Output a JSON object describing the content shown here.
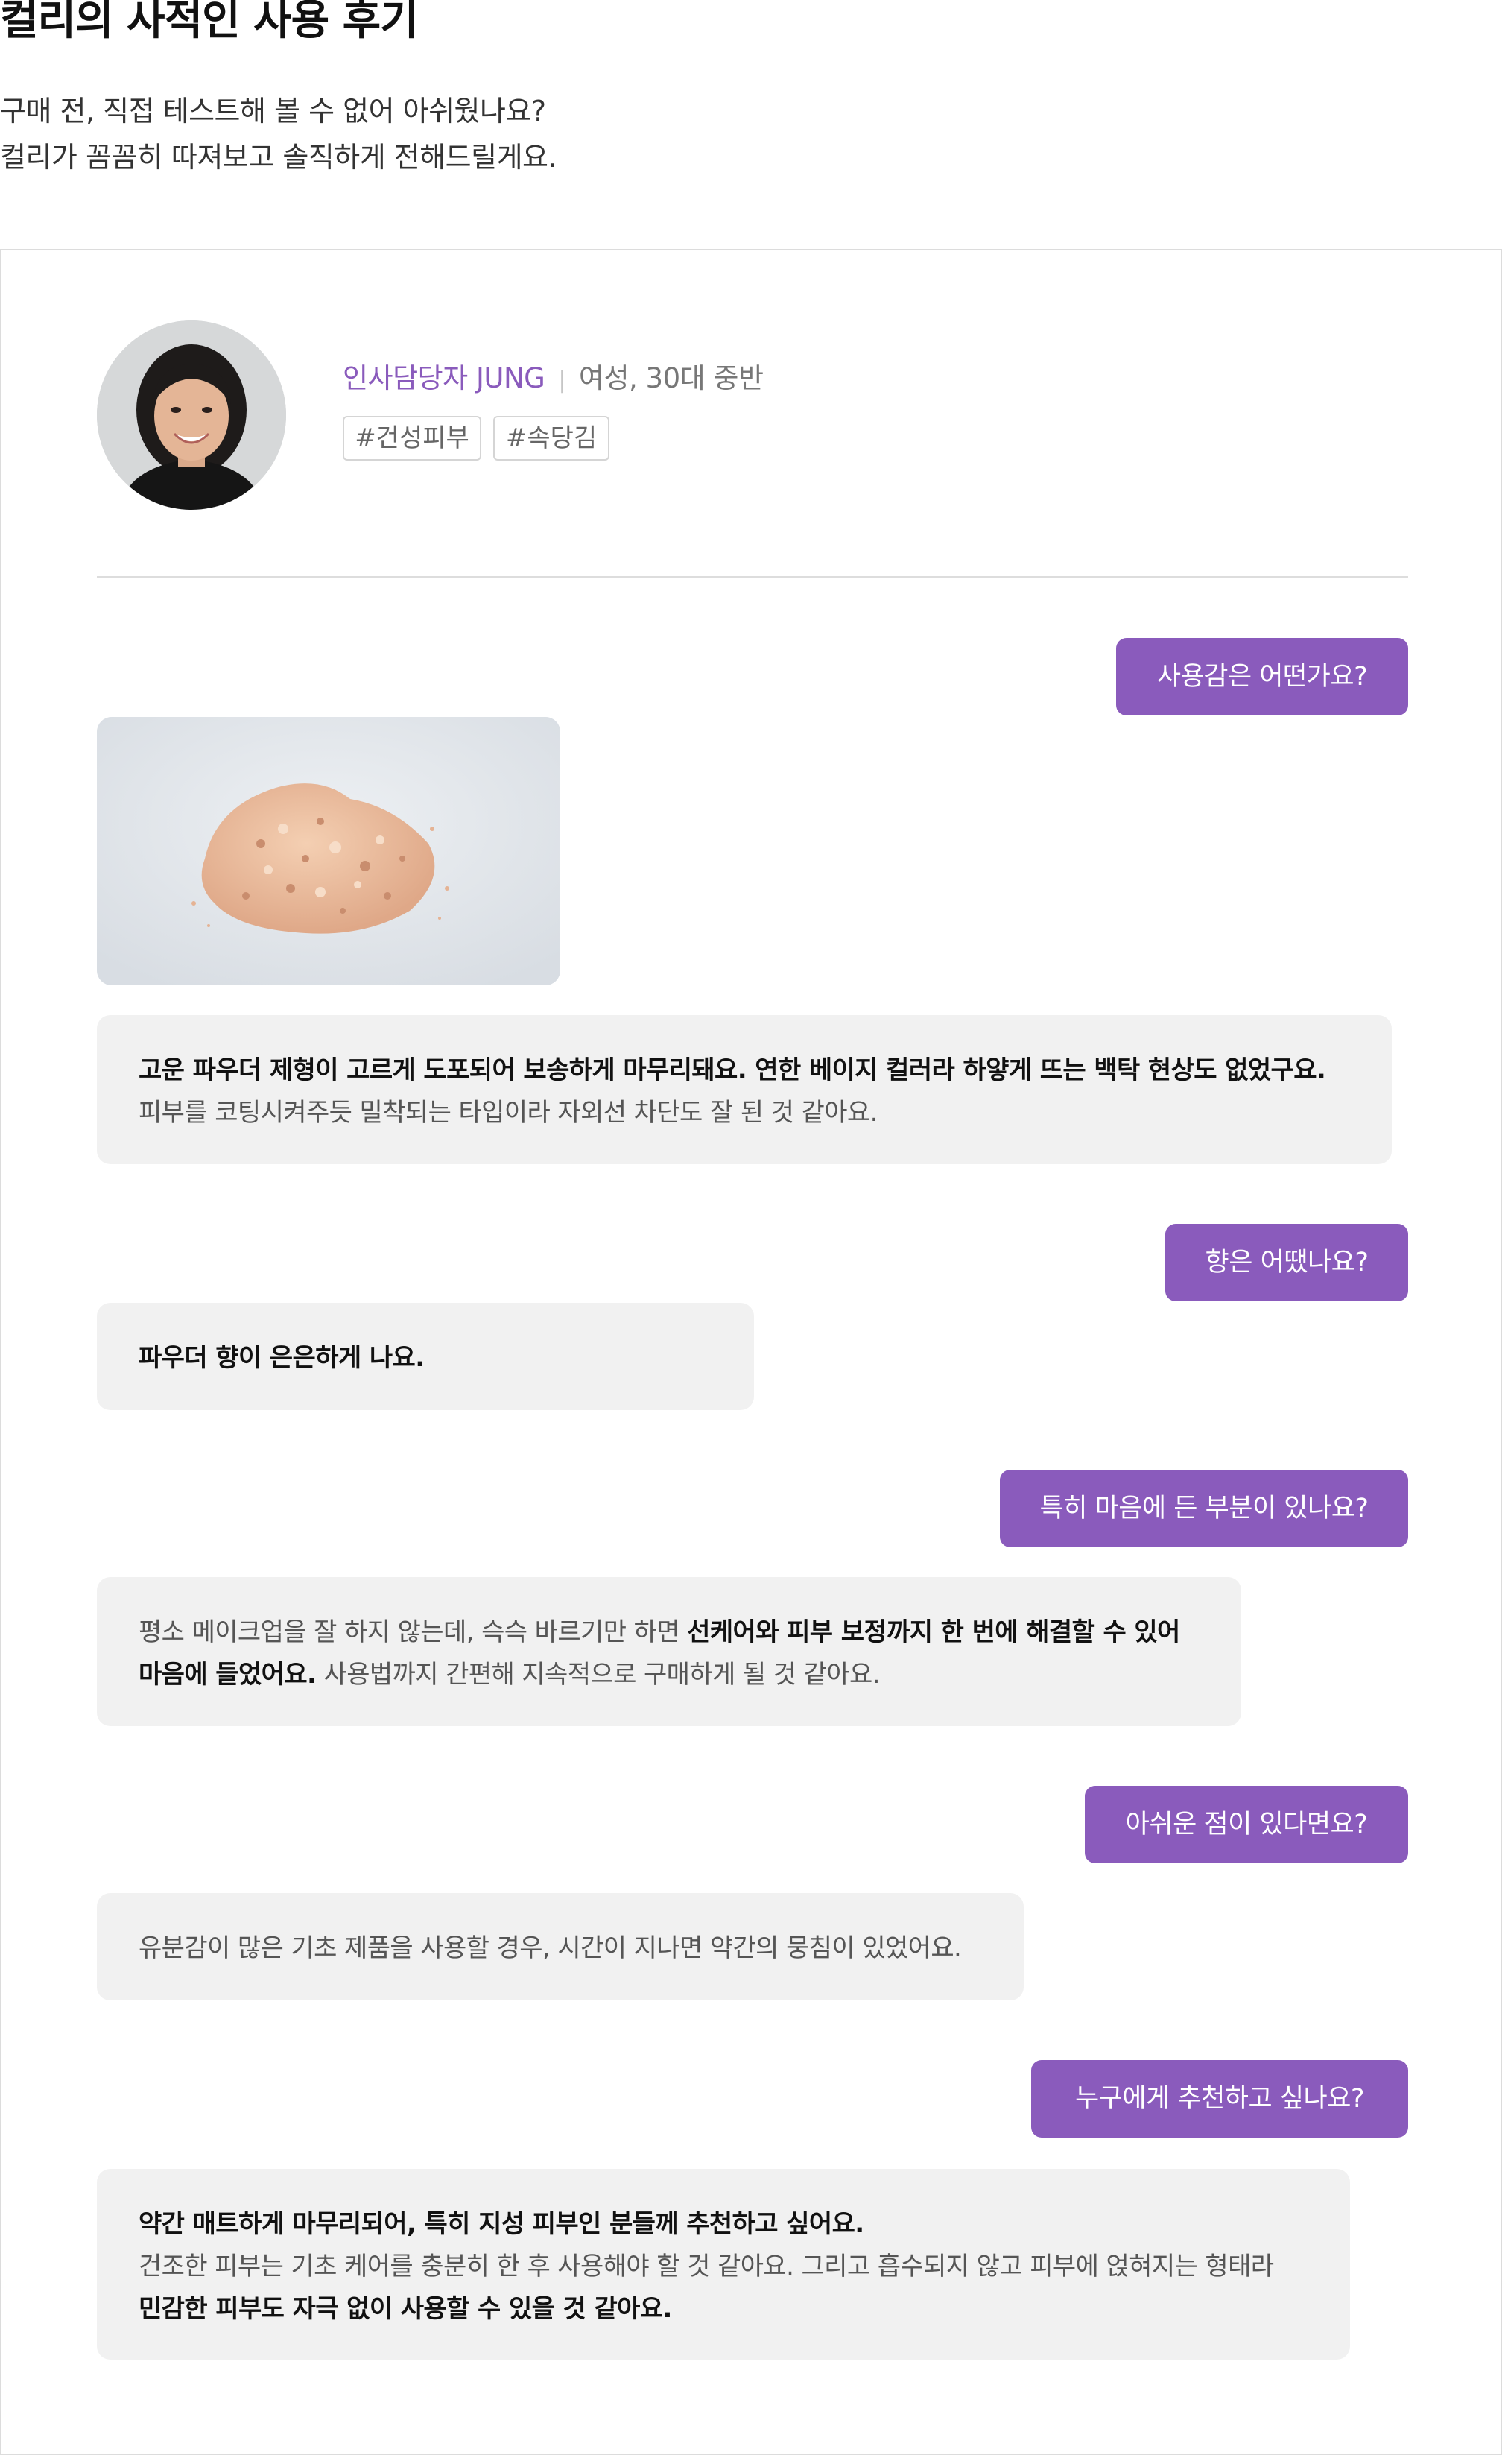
{
  "page": {
    "title": "컬리의 사적인 사용 후기",
    "intro_line1": "구매 전, 직접 테스트해 볼 수 없어 아쉬웠나요?",
    "intro_line2": "컬리가 꼼꼼히 따져보고 솔직하게 전해드릴게요."
  },
  "reviewer": {
    "role": "인사담당자 JUNG",
    "demographic": "여성, 30대 중반",
    "tags": [
      "#건성피부",
      "#속당김"
    ]
  },
  "qa": [
    {
      "question": "사용감은 어떤가요?",
      "answer_line1": "고운 파우더 제형이 고르게 도포되어 보송하게 마무리돼요. 연한 베이지 컬러라 하얗게 뜨는 백탁 현상도 없었구요.",
      "answer_line2": "피부를 코팅시켜주듯 밀착되는 타입이라 자외선 차단도 잘 된 것 같아요."
    },
    {
      "question": "향은 어땠나요?",
      "answer_line1": "파우더 향이 은은하게 나요."
    },
    {
      "question": "특히 마음에 든 부분이 있나요?",
      "answer_line1_normal": "평소 메이크업을 잘 하지 않는데, 슥슥 바르기만 하면 ",
      "answer_line1_bold": "선케어와 피부 보정까지 한 번에 해결할 수 있어",
      "answer_line2_bold": "마음에 들었어요.",
      "answer_line2_normal": " 사용법까지 간편해 지속적으로 구매하게 될 것 같아요."
    },
    {
      "question": "아쉬운 점이 있다면요?",
      "answer_line1": "유분감이 많은 기초 제품을 사용할 경우, 시간이 지나면 약간의 뭉침이 있었어요."
    },
    {
      "question": "누구에게 추천하고 싶나요?",
      "answer_line1": "약간 매트하게 마무리되어, 특히 지성 피부인 분들께 추천하고 싶어요.",
      "answer_line2": "건조한 피부는 기초 케어를 충분히 한 후 사용해야 할 것 같아요. 그리고 흡수되지 않고 피부에 얹혀지는 형태라",
      "answer_line3": "민감한 피부도 자극 없이 사용할 수 있을 것 같아요."
    }
  ],
  "colors": {
    "accent": "#8a5bbc",
    "bubble_bg": "#f1f1f1",
    "border": "#dcdcdc"
  },
  "icons": {
    "reviewer_photo": "reviewer-avatar",
    "product_photo": "powder-product-photo"
  }
}
